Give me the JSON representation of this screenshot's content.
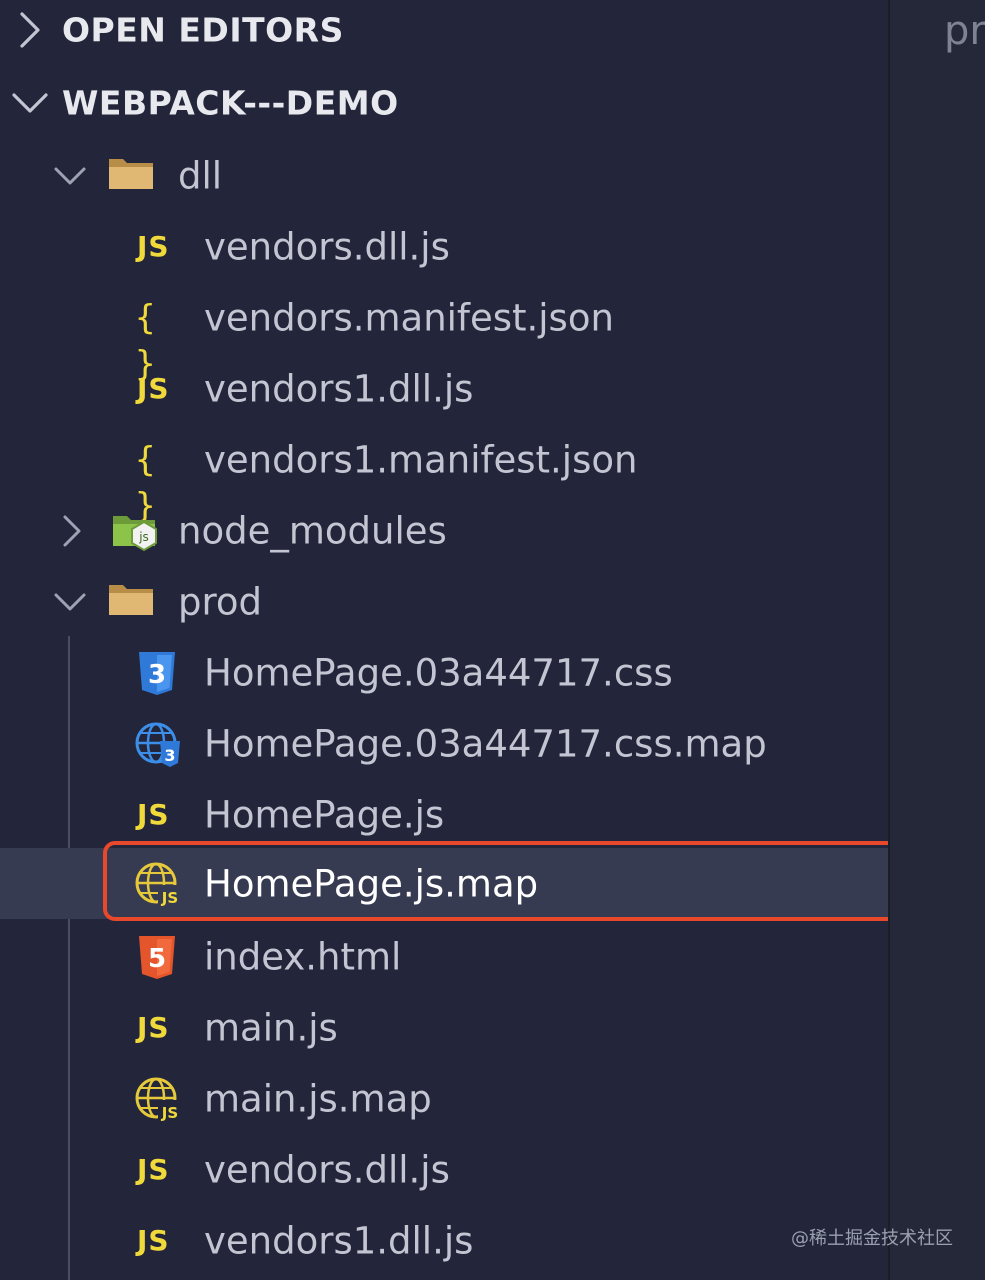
{
  "sections": {
    "open_editors": {
      "label": "OPEN EDITORS",
      "expanded": false
    },
    "project": {
      "label": "WEBPACK---DEMO",
      "expanded": true
    }
  },
  "tree": {
    "dll": {
      "name": "dll",
      "expanded": true,
      "files": [
        {
          "name": "vendors.dll.js",
          "icon": "js-icon"
        },
        {
          "name": "vendors.manifest.json",
          "icon": "json-icon"
        },
        {
          "name": "vendors1.dll.js",
          "icon": "js-icon"
        },
        {
          "name": "vendors1.manifest.json",
          "icon": "json-icon"
        }
      ]
    },
    "node_modules": {
      "name": "node_modules",
      "expanded": false
    },
    "prod": {
      "name": "prod",
      "expanded": true,
      "files": [
        {
          "name": "HomePage.03a44717.css",
          "icon": "css3-icon"
        },
        {
          "name": "HomePage.03a44717.css.map",
          "icon": "css-map-globe-icon"
        },
        {
          "name": "HomePage.js",
          "icon": "js-icon"
        },
        {
          "name": "HomePage.js.map",
          "icon": "js-map-globe-icon",
          "selected": true
        },
        {
          "name": "index.html",
          "icon": "html5-icon"
        },
        {
          "name": "main.js",
          "icon": "js-icon"
        },
        {
          "name": "main.js.map",
          "icon": "js-map-globe-icon"
        },
        {
          "name": "vendors.dll.js",
          "icon": "js-icon"
        },
        {
          "name": "vendors1.dll.js",
          "icon": "js-icon"
        }
      ]
    }
  },
  "icons": {
    "js_text": "JS",
    "json_text": "{ }",
    "css3_text": "3",
    "html5_text": "5",
    "js_map_badge": "JS"
  },
  "editor": {
    "tab_partial": "pr"
  },
  "watermark": "@稀土掘金技术社区",
  "colors": {
    "background": "#23263a",
    "selected_row": "#373b51",
    "highlight_border": "#e8482c",
    "js_yellow": "#f0d93a",
    "css_blue": "#2f79d8",
    "html_orange": "#e4552b",
    "folder": "#d9b06a",
    "node_green": "#8cc44a"
  }
}
